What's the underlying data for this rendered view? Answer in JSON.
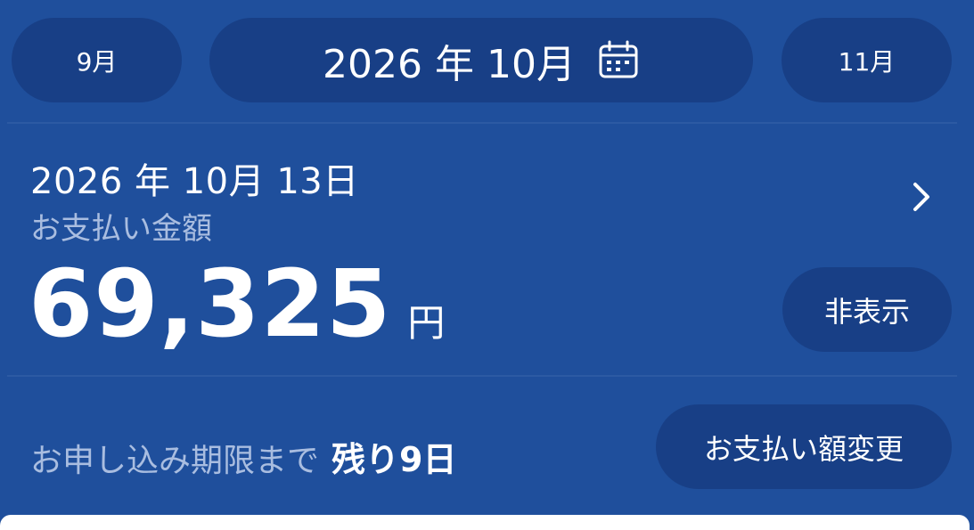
{
  "month_nav": {
    "prev_label": "9月",
    "current_label": "2026 年 10月",
    "next_label": "11月",
    "calendar_icon": "calendar-icon"
  },
  "payment": {
    "date": "2026 年 10月 13日",
    "label": "お支払い金額",
    "amount": "69,325",
    "unit": "円",
    "hide_label": "非表示",
    "chevron_icon": "chevron-right-icon"
  },
  "deadline": {
    "text": "お申し込み期限まで",
    "remaining": "残り9日",
    "change_label": "お支払い額変更"
  },
  "colors": {
    "background": "#1f4f9c",
    "pill": "#183f86",
    "muted_text": "#a9bde0"
  }
}
